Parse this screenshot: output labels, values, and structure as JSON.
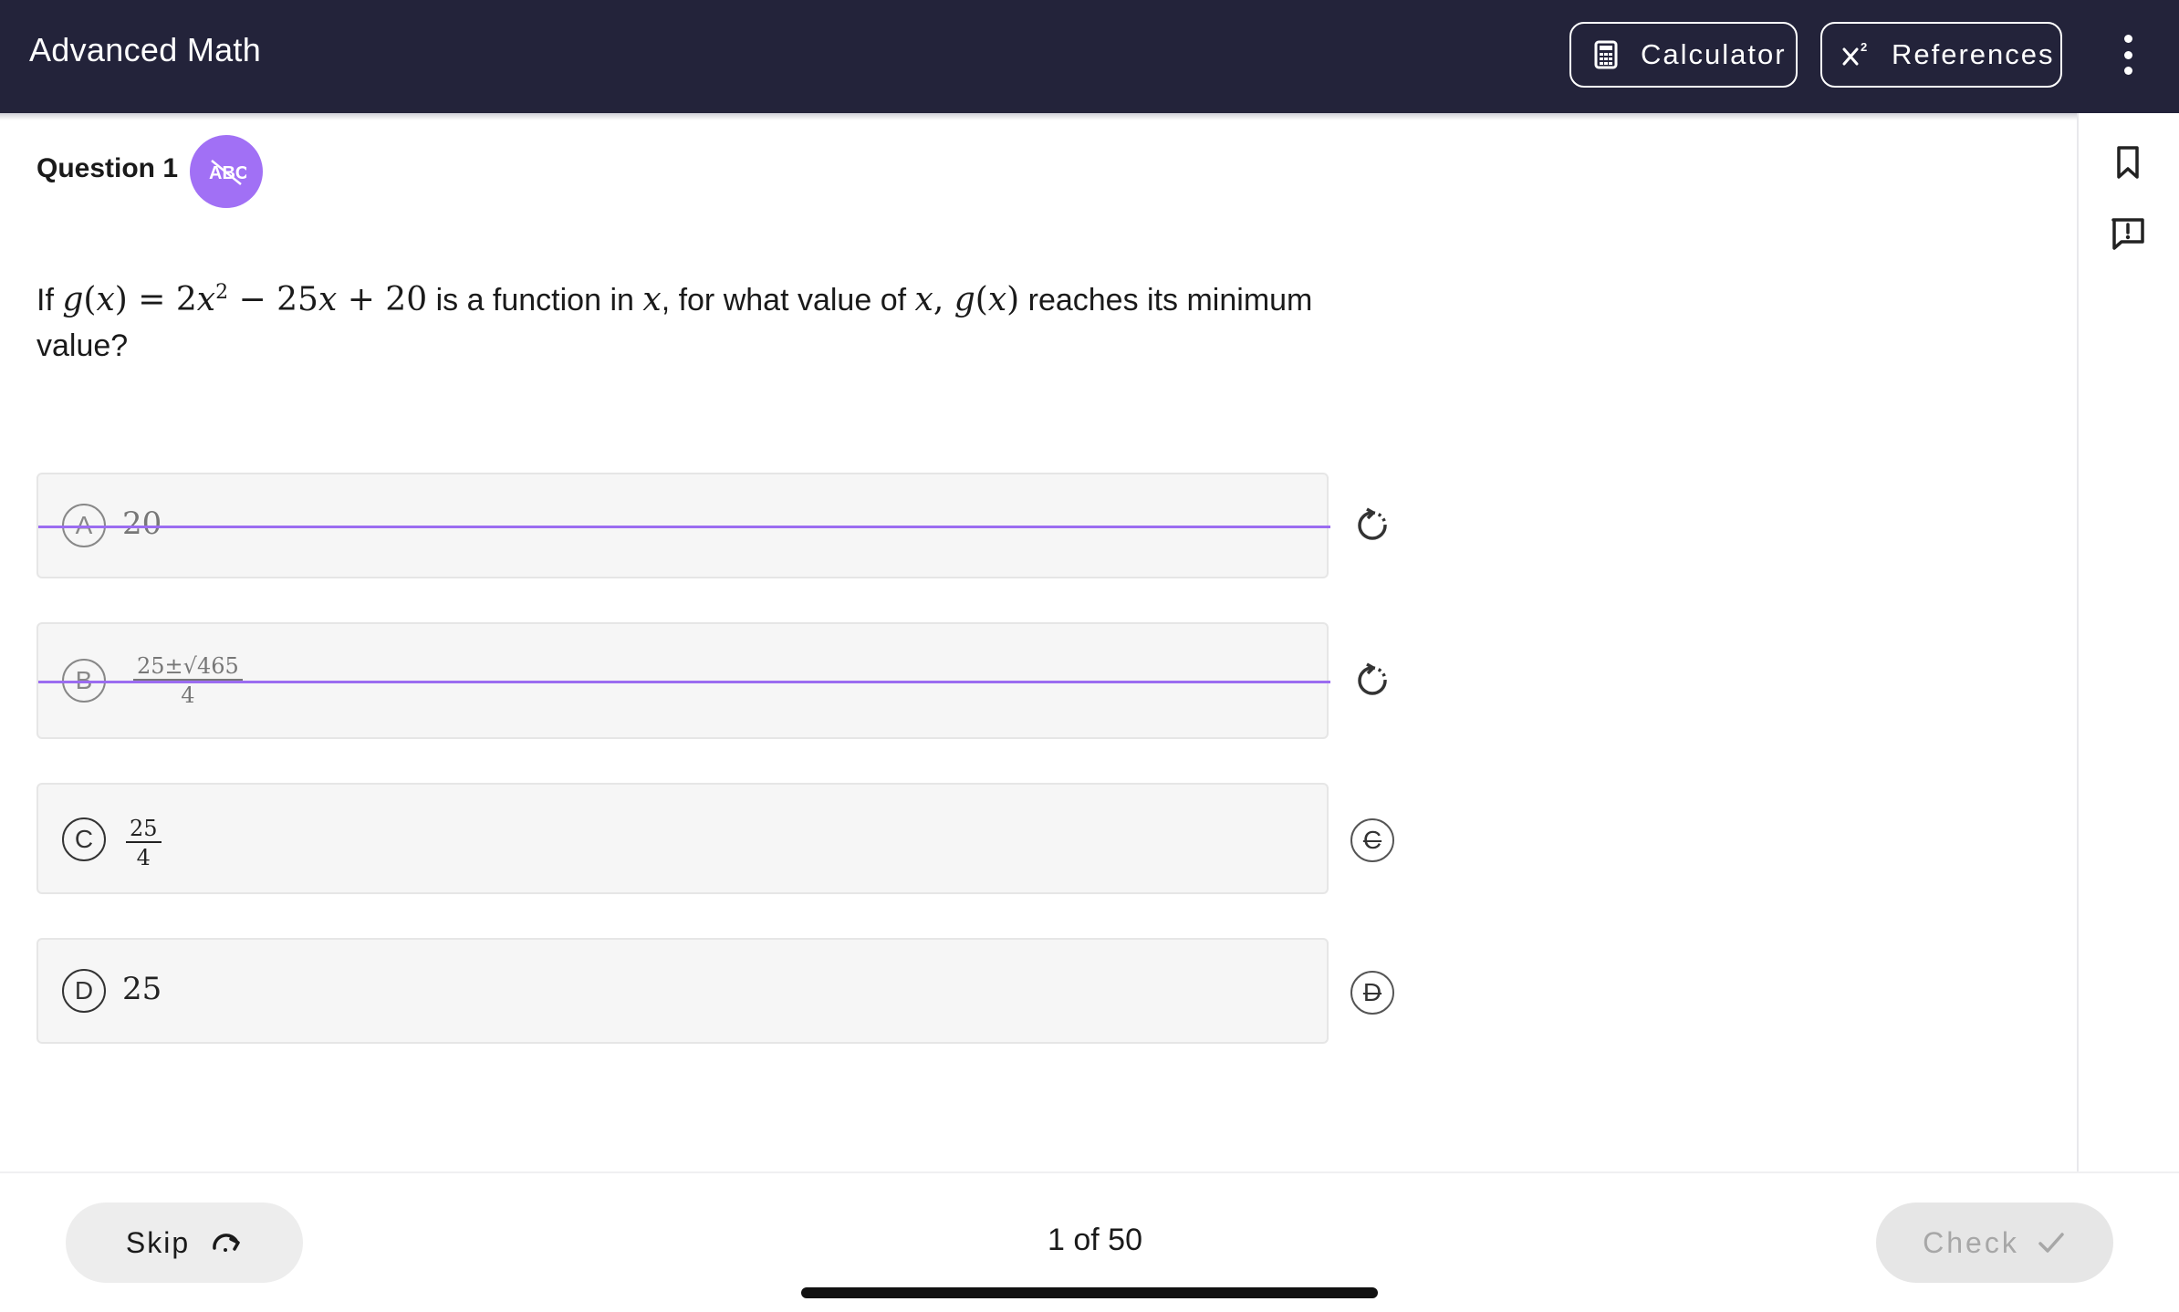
{
  "header": {
    "title": "Advanced Math",
    "calculator_label": "Calculator",
    "references_label": "References"
  },
  "question": {
    "label": "Question 1",
    "badge_text": "ABC",
    "text_if": "If",
    "text_is_function": "is a function in",
    "text_for_what": ", for what value of",
    "text_reaches": "reaches its minimum",
    "text_value": "value?"
  },
  "choices": [
    {
      "letter": "A",
      "value": "20",
      "eliminated": true,
      "action": "undo"
    },
    {
      "letter": "B",
      "numerator": "25±√465",
      "denominator": "4",
      "eliminated": true,
      "action": "undo"
    },
    {
      "letter": "C",
      "numerator": "25",
      "denominator": "4",
      "eliminated": false,
      "action": "C"
    },
    {
      "letter": "D",
      "value": "25",
      "eliminated": false,
      "action": "D"
    }
  ],
  "footer": {
    "skip_label": "Skip",
    "progress": "1 of 50",
    "check_label": "Check"
  },
  "colors": {
    "header_bg": "#23233a",
    "accent_purple": "#a170f5",
    "strike_line": "#9b6cf0"
  },
  "icons": {
    "calculator": "calculator-icon",
    "references": "superscript-icon",
    "menu": "kebab-menu-icon",
    "bookmark": "bookmark-icon",
    "feedback": "report-comment-icon",
    "undo": "undo-circle-icon",
    "skip": "skip-arrow-icon",
    "check": "check-icon"
  }
}
